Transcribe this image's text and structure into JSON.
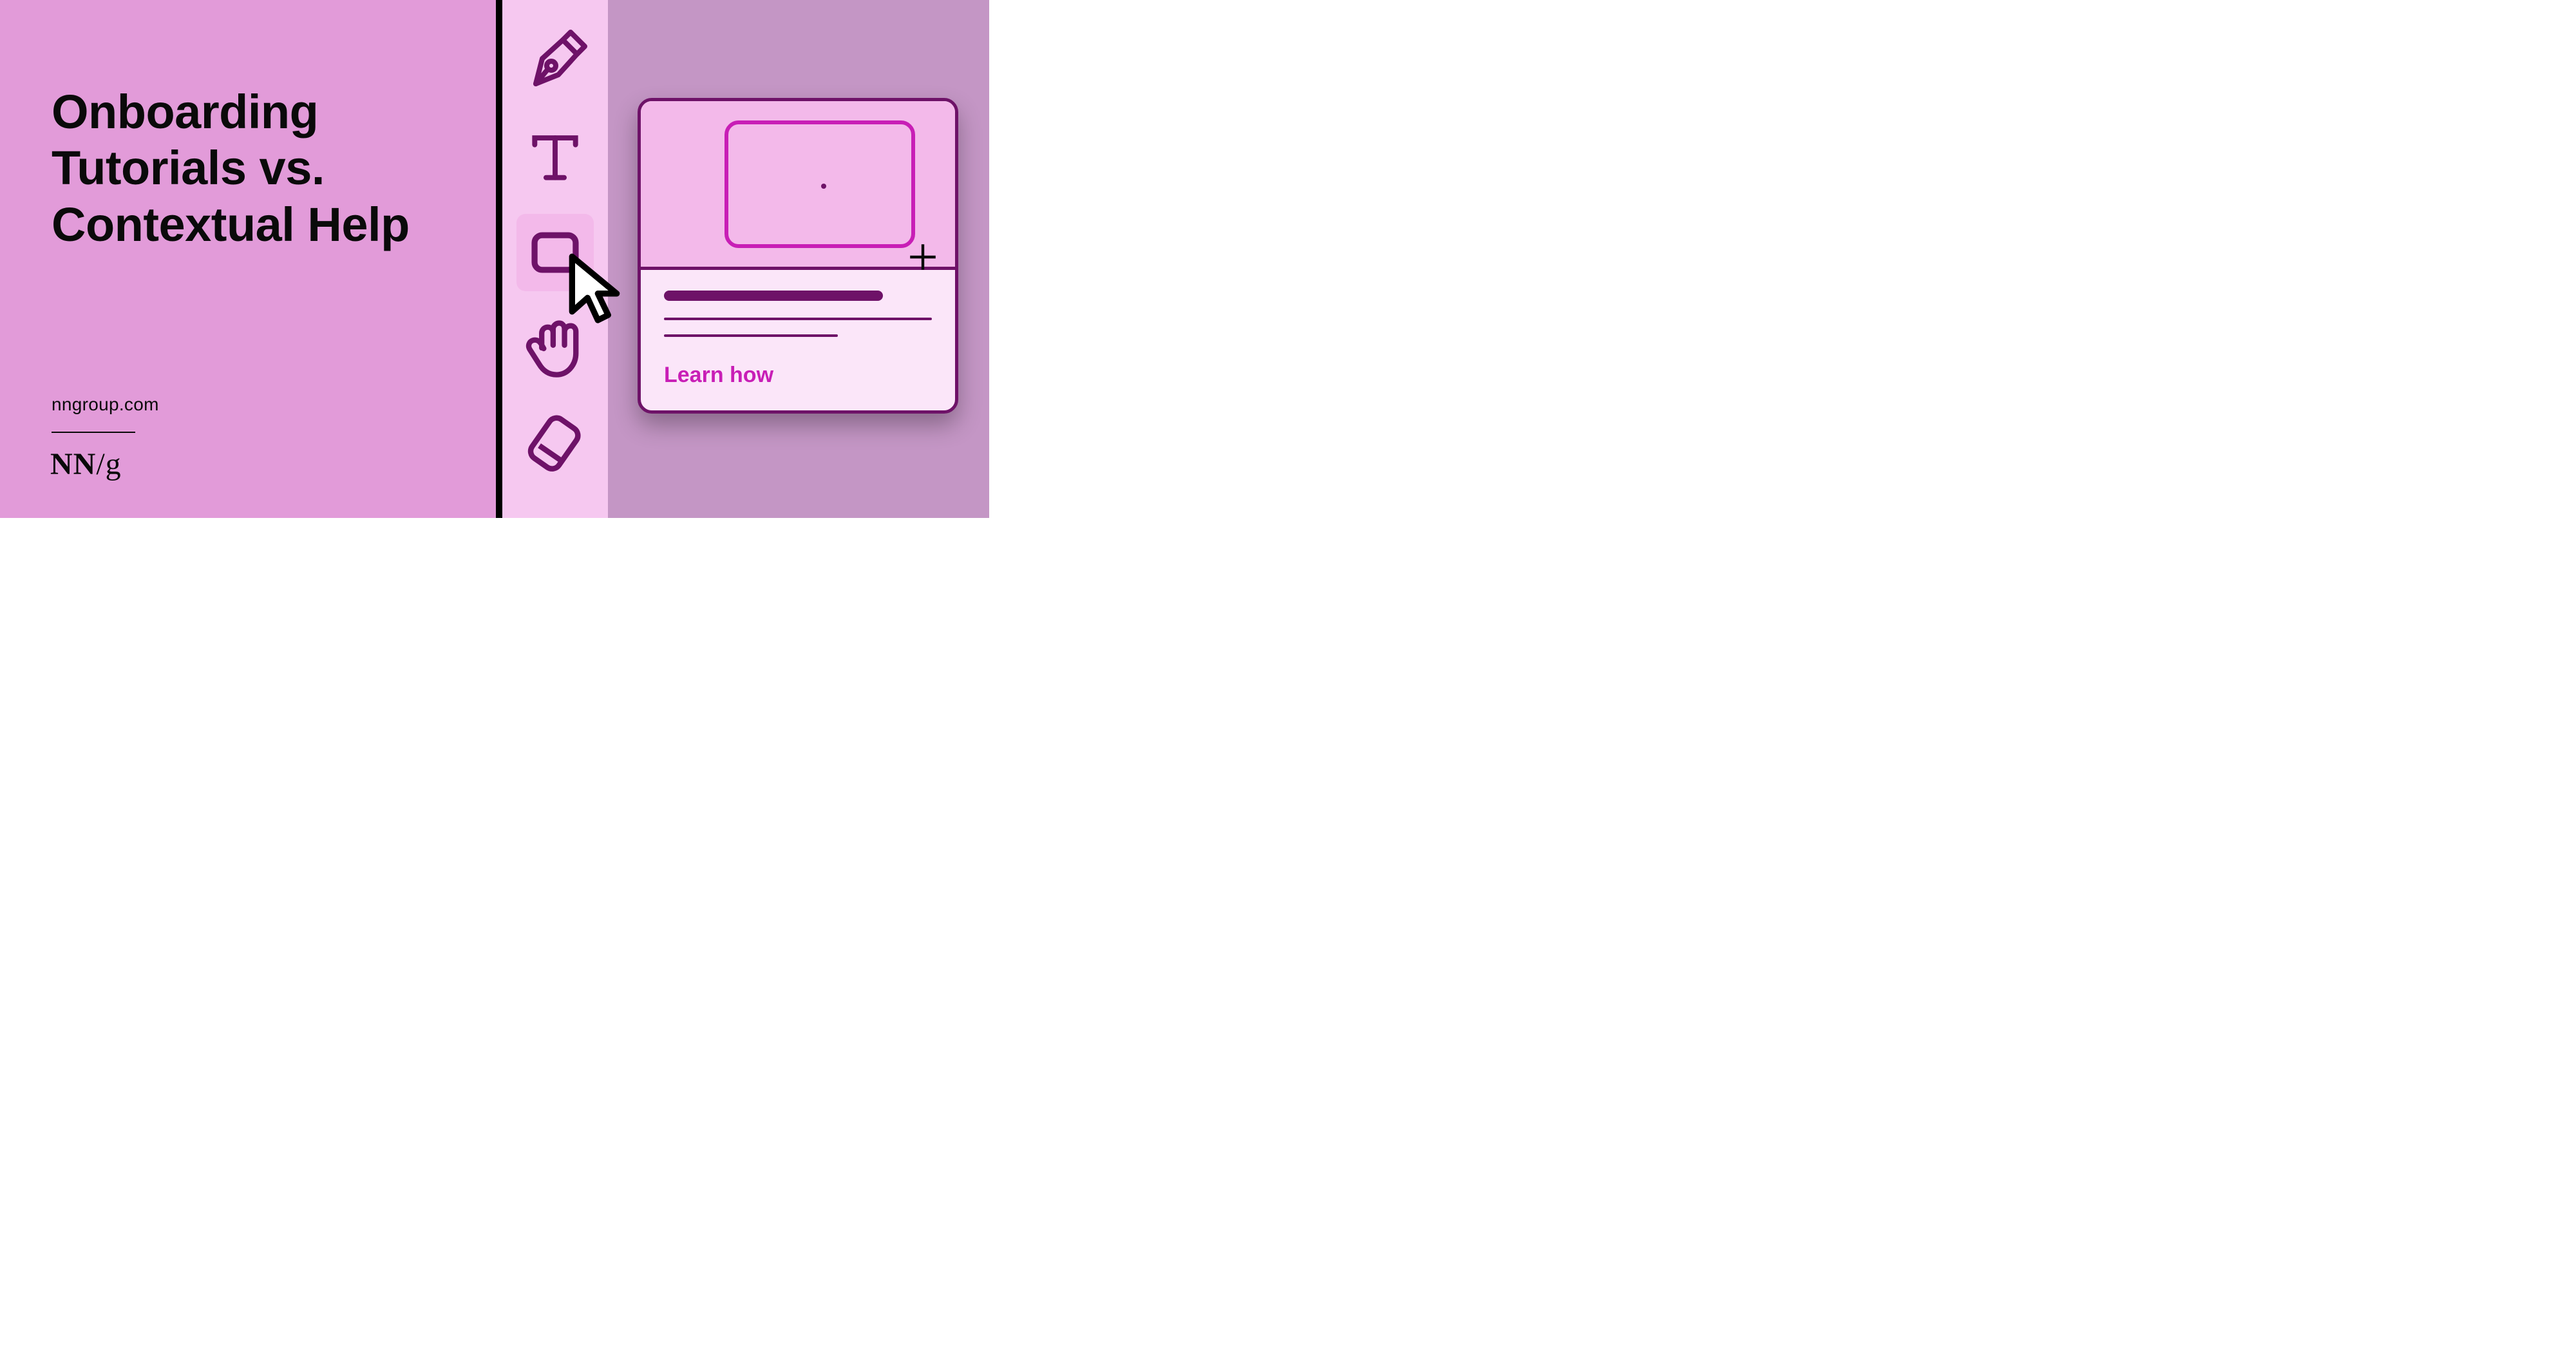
{
  "title_line1": "Onboarding",
  "title_line2": "Tutorials vs.",
  "title_line3": "Contextual Help",
  "site": "nngroup.com",
  "logo_nn": "NN",
  "logo_slash": "/",
  "logo_g": "g",
  "popover": {
    "cta": "Learn how"
  },
  "colors": {
    "left_bg": "#e29bd9",
    "toolbar_bg": "#f6c8f0",
    "right_bg": "#c496c5",
    "stroke_dark": "#6e1268",
    "accent_pink": "#c81eb6"
  },
  "toolbar": {
    "items": [
      {
        "name": "pen-tool-icon",
        "selected": false
      },
      {
        "name": "text-tool-icon",
        "selected": false
      },
      {
        "name": "rectangle-tool-icon",
        "selected": true
      },
      {
        "name": "hand-tool-icon",
        "selected": false
      },
      {
        "name": "eraser-tool-icon",
        "selected": false
      }
    ]
  }
}
